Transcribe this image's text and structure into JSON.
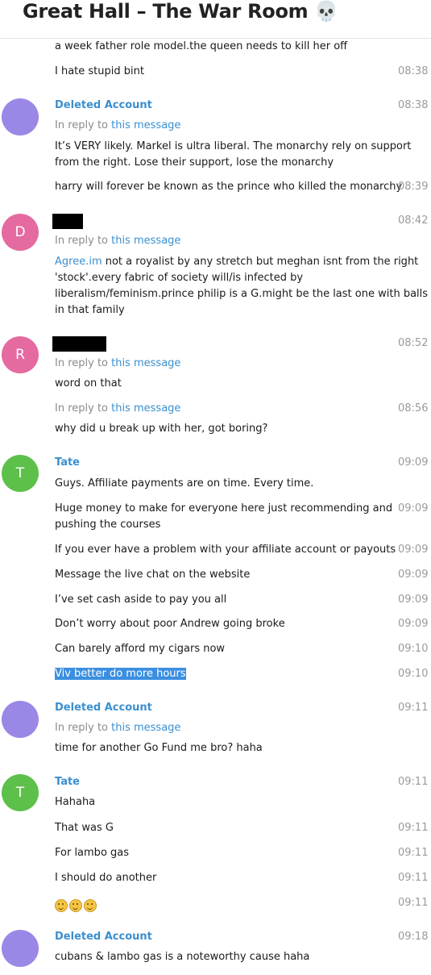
{
  "header": {
    "title": "Great Hall – The War Room 💀"
  },
  "colors": {
    "link": "#3a8fd0",
    "purple": "#9b87e6",
    "pink": "#e56aa0",
    "green": "#5cc04a",
    "highlight": "#3b8fe0"
  },
  "messages": {
    "m0": {
      "text": "a week father role model.the queen needs to kill her off"
    },
    "m1": {
      "text": "I hate stupid bint",
      "time": "08:38"
    },
    "g1": {
      "name": "Deleted Account",
      "time": "08:38",
      "reply_prefix": "In reply to ",
      "reply_link": "this message",
      "text": "It’s VERY likely. Markel is ultra liberal. The monarchy rely on support\nfrom the right. Lose their support, lose the monarchy"
    },
    "m2": {
      "text": "harry will forever be known as the prince who killed the monarchy",
      "time": "08:39"
    },
    "g2": {
      "avatar": "D",
      "time": "08:42",
      "reply_prefix": "In reply to ",
      "reply_link": "this message",
      "text_link": "Agree.im",
      "text": " not a royalist by any stretch but meghan isnt from the right\n'stock'.every fabric of society will/is infected by\nliberalism/feminism.prince philip is a G.might be the last one with balls\nin that family"
    },
    "g3": {
      "avatar": "R",
      "time": "08:52",
      "reply_prefix": "In reply to ",
      "reply_link": "this message",
      "text": "word on that"
    },
    "m3": {
      "reply_prefix": "In reply to ",
      "reply_link": "this message",
      "time": "08:56",
      "text": "why did u break up with her, got boring?"
    },
    "g4": {
      "avatar": "T",
      "name": "Tate",
      "time": "09:09",
      "text": "Guys. Affiliate payments are on time. Every time."
    },
    "m4": {
      "text": "Huge money to make for everyone here just recommending and\npushing the courses",
      "time": "09:09"
    },
    "m5": {
      "text": "If you ever have a problem with your affiliate account or payouts",
      "time": "09:09"
    },
    "m6": {
      "text": "Message the live chat on the website",
      "time": "09:09"
    },
    "m7": {
      "text": "I’ve set cash aside to pay you all",
      "time": "09:09"
    },
    "m8": {
      "text": "Don’t worry about poor Andrew going broke",
      "time": "09:09"
    },
    "m9": {
      "text": "Can barely afford my cigars now",
      "time": "09:10"
    },
    "m10": {
      "text": "Viv better do more hours",
      "time": "09:10"
    },
    "g5": {
      "name": "Deleted Account",
      "time": "09:11",
      "reply_prefix": "In reply to ",
      "reply_link": "this message",
      "text": "time for another Go Fund me bro? haha"
    },
    "g6": {
      "avatar": "T",
      "name": "Tate",
      "time": "09:11",
      "text": "Hahaha"
    },
    "m11": {
      "text": "That was G",
      "time": "09:11"
    },
    "m12": {
      "text": "For lambo gas",
      "time": "09:11"
    },
    "m13": {
      "text": "I should do another",
      "time": "09:11"
    },
    "m14": {
      "emoji": "smirk-face",
      "time": "09:11"
    },
    "g7": {
      "name": "Deleted Account",
      "time": "09:18",
      "text": "cubans & lambo gas is a noteworthy cause haha"
    }
  }
}
